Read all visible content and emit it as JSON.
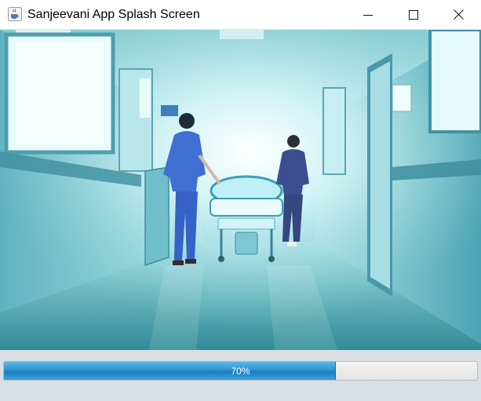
{
  "window": {
    "title": "Sanjeevani App Splash Screen",
    "icon": "java-coffee-cup-icon",
    "controls": {
      "minimize_icon": "minimize-icon",
      "maximize_icon": "maximize-icon",
      "close_icon": "close-icon"
    }
  },
  "splash": {
    "image": "hospital-corridor-photo",
    "colors": {
      "tint": "#7ad3dd",
      "accent": "#2f95d2"
    }
  },
  "progress": {
    "value": 0.7,
    "label": "70%",
    "fill_color": "#2f95d2"
  }
}
